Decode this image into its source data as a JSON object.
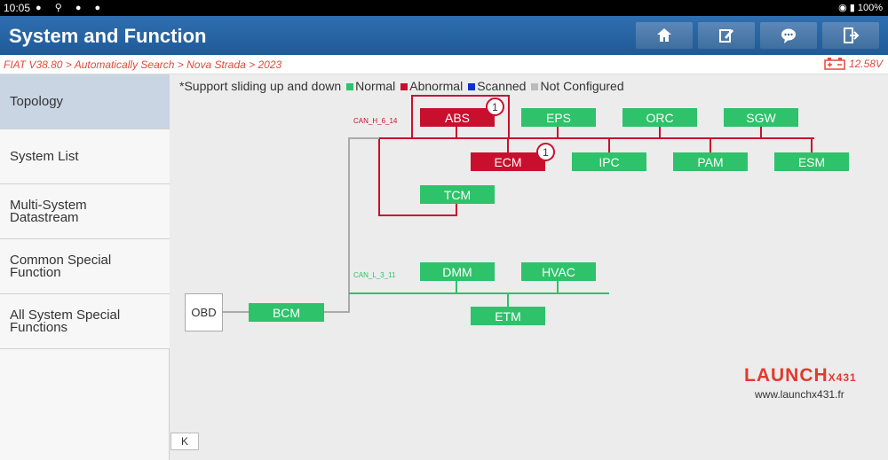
{
  "status_bar": {
    "time": "10:05",
    "battery": "100%"
  },
  "header": {
    "title": "System and Function"
  },
  "toolbar": {
    "buttons": [
      {
        "name": "home-button",
        "icon": "home-icon"
      },
      {
        "name": "report-button",
        "icon": "edit-icon"
      },
      {
        "name": "feedback-button",
        "icon": "chat-icon"
      },
      {
        "name": "exit-button",
        "icon": "exit-icon"
      }
    ]
  },
  "breadcrumb": {
    "path": "FIAT V38.80 > Automatically Search > Nova Strada > 2023",
    "voltage": "12.58V"
  },
  "sidebar": {
    "items": [
      {
        "label": "Topology",
        "active": true
      },
      {
        "label": "System List"
      },
      {
        "label": "Multi-System\nDatastream"
      },
      {
        "label": "Common Special\nFunction"
      },
      {
        "label": "All System Special\nFunctions"
      }
    ]
  },
  "legend": {
    "hint": "*Support sliding up and down",
    "normal": "Normal",
    "abnormal": "Abnormal",
    "scanned": "Scanned",
    "not_configured": "Not Configured",
    "colors": {
      "normal": "#2ec26a",
      "abnormal": "#c8102e",
      "scanned": "#1030c8",
      "not_configured": "#bbbbbb"
    }
  },
  "topology": {
    "obd": "OBD",
    "bus_h": "CAN_H_6_14",
    "bus_l": "CAN_L_3_11",
    "nodes": {
      "abs": "ABS",
      "eps": "EPS",
      "orc": "ORC",
      "sgw": "SGW",
      "ecm": "ECM",
      "ipc": "IPC",
      "pam": "PAM",
      "esm": "ESM",
      "tcm": "TCM",
      "dmm": "DMM",
      "hvac": "HVAC",
      "etm": "ETM",
      "bcm": "BCM"
    },
    "abs_faults": "1",
    "ecm_faults": "1"
  },
  "brand": {
    "logo": "LAUNCH",
    "logo_suffix": "X431",
    "url": "www.launchx431.fr"
  },
  "collapse_label": "K"
}
